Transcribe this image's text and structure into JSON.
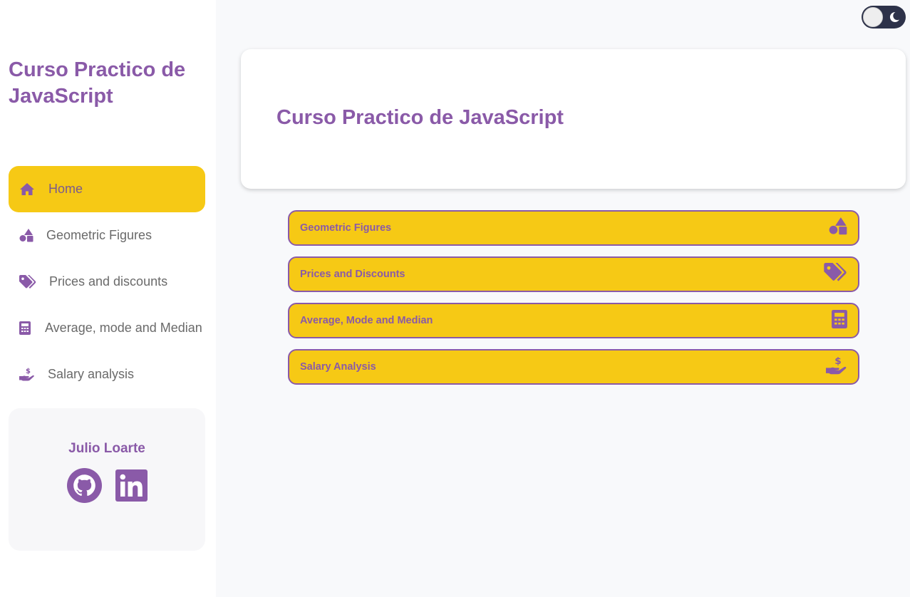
{
  "sidebar": {
    "title": "Curso Practico de JavaScript",
    "nav": [
      {
        "label": "Home",
        "icon": "home-icon",
        "active": true
      },
      {
        "label": "Geometric Figures",
        "icon": "shapes-icon"
      },
      {
        "label": "Prices and discounts",
        "icon": "tags-icon"
      },
      {
        "label": "Average, mode and Median",
        "icon": "calculator-icon"
      },
      {
        "label": "Salary analysis",
        "icon": "hand-holding-dollar-icon"
      }
    ],
    "profile": {
      "name": "Julio Loarte",
      "links": [
        {
          "icon": "github-icon"
        },
        {
          "icon": "linkedin-icon"
        }
      ]
    }
  },
  "theme_toggle": {
    "icon": "moon-icon",
    "state": "light"
  },
  "main": {
    "hero_title": "Curso Practico de JavaScript",
    "cards": [
      {
        "label": "Geometric Figures",
        "icon": "shapes-icon"
      },
      {
        "label": "Prices and Discounts",
        "icon": "tags-icon"
      },
      {
        "label": "Average, Mode and Median",
        "icon": "calculator-icon"
      },
      {
        "label": "Salary Analysis",
        "icon": "hand-holding-dollar-icon"
      }
    ]
  },
  "colors": {
    "accent": "#8a5aa8",
    "highlight": "#f6c915",
    "toggle_bg": "#2d3249",
    "background": "#f8f9fb"
  }
}
